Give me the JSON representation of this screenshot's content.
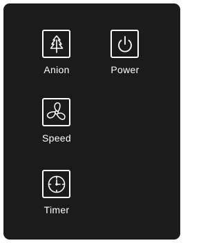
{
  "buttons": {
    "anion": {
      "label": "Anion",
      "icon": "tree-icon"
    },
    "power": {
      "label": "Power",
      "icon": "power-icon"
    },
    "speed": {
      "label": "Speed",
      "icon": "fan-icon"
    },
    "timer": {
      "label": "Timer",
      "icon": "clock-icon"
    }
  },
  "colors": {
    "background": "#1b1b1b",
    "foreground": "#ffffff"
  }
}
